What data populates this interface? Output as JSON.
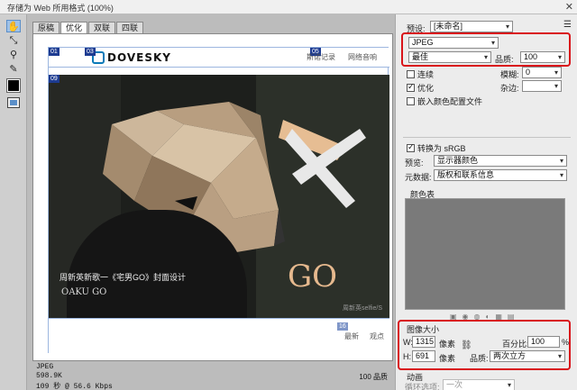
{
  "window": {
    "title": "存储为 Web 所用格式 (100%)",
    "close_label": "✕"
  },
  "toolbar": {
    "tools": [
      {
        "name": "hand-tool-icon",
        "glyph": "✋"
      },
      {
        "name": "slice-select-tool-icon",
        "glyph": "⤡"
      },
      {
        "name": "zoom-tool-icon",
        "glyph": "⚲"
      },
      {
        "name": "eyedropper-tool-icon",
        "glyph": "✎"
      }
    ]
  },
  "preview": {
    "tabs": [
      "原稿",
      "优化",
      "双联",
      "四联"
    ],
    "active_tab": "优化",
    "site": {
      "logo_text": "DOVESKY",
      "nav": [
        "斯诺记录",
        "网络音响"
      ],
      "slice_tags": [
        "01",
        "03",
        "05",
        "09",
        "16"
      ],
      "hero_caption": "周新英新歌一《宅男GO》封面设计",
      "hero_watermark": "OAKU GO",
      "hero_watermark2": "周新英selfie/S",
      "footer_nav": [
        "最新",
        "观点"
      ]
    },
    "status": {
      "format": "JPEG",
      "size": "598.9K",
      "time": "109 秒 @ 56.6 Kbps",
      "quality": "100 品质"
    }
  },
  "settings": {
    "preset_label": "预设:",
    "preset_value": "[未命名]",
    "format_value": "JPEG",
    "quality_level": "最佳",
    "quality_label": "品质:",
    "quality_value": "100",
    "progressive_label": "连续",
    "optimized_label": "优化",
    "embed_profile_label": "嵌入颜色配置文件",
    "blur_label": "模糊:",
    "blur_value": "0",
    "matte_label": "杂边:",
    "convert_srgb_label": "转换为 sRGB",
    "preview_label": "预览:",
    "preview_value": "显示器颜色",
    "metadata_label": "元数据:",
    "metadata_value": "版权和联系信息",
    "color_table_label": "颜色表",
    "image_size_label": "图像大小",
    "width_label": "W:",
    "width_value": "1315",
    "height_label": "H:",
    "height_value": "691",
    "unit_label": "像素",
    "percent_label": "百分比:",
    "percent_value": "100",
    "percent_unit": "%",
    "resample_label": "品质:",
    "resample_value": "两次立方",
    "animation_label": "动画",
    "loop_label": "循环选项:",
    "loop_value": "一次"
  }
}
